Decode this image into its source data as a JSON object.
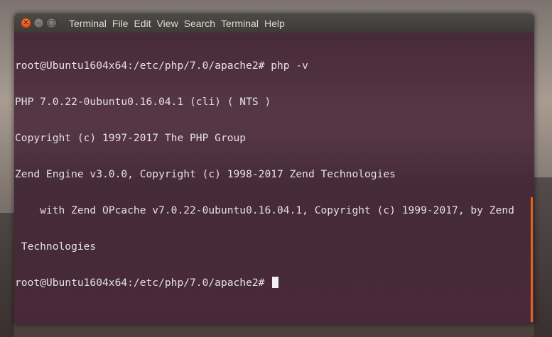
{
  "window": {
    "title_menu": [
      "Terminal",
      "File",
      "Edit",
      "View",
      "Search",
      "Terminal",
      "Help"
    ]
  },
  "terminal": {
    "lines": [
      "root@Ubuntu1604x64:/etc/php/7.0/apache2# php -v",
      "PHP 7.0.22-0ubuntu0.16.04.1 (cli) ( NTS )",
      "Copyright (c) 1997-2017 The PHP Group",
      "Zend Engine v3.0.0, Copyright (c) 1998-2017 Zend Technologies",
      "    with Zend OPcache v7.0.22-0ubuntu0.16.04.1, Copyright (c) 1999-2017, by Zend",
      " Technologies"
    ],
    "prompt": "root@Ubuntu1604x64:/etc/php/7.0/apache2# "
  },
  "colors": {
    "accent": "#e2531d",
    "terminal_text": "#e4e0e6",
    "terminal_bg": "#3e1e2e"
  },
  "icons": {
    "close": "close-icon",
    "minimize": "minimize-icon",
    "maximize": "maximize-icon"
  }
}
